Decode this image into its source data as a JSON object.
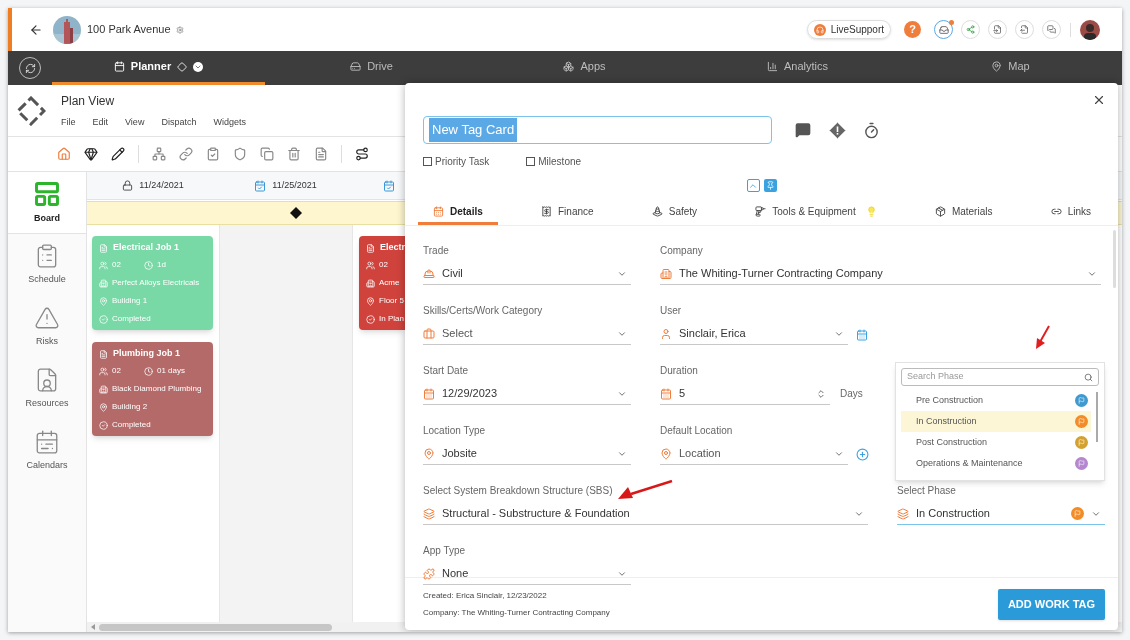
{
  "header": {
    "project_name": "100 Park Avenue",
    "live_support": "LiveSupport",
    "help": "?"
  },
  "nav": {
    "tabs": [
      {
        "label": "Planner",
        "selected": true
      },
      {
        "label": "Drive",
        "selected": false
      },
      {
        "label": "Apps",
        "selected": false
      },
      {
        "label": "Analytics",
        "selected": false
      },
      {
        "label": "Map",
        "selected": false
      }
    ]
  },
  "plan_view": {
    "title": "Plan View",
    "menu": [
      "File",
      "Edit",
      "View",
      "Dispatch",
      "Widgets"
    ]
  },
  "sidebar": {
    "items": [
      {
        "label": "Board",
        "selected": true
      },
      {
        "label": "Schedule",
        "selected": false
      },
      {
        "label": "Risks",
        "selected": false
      },
      {
        "label": "Resources",
        "selected": false
      },
      {
        "label": "Calendars",
        "selected": false
      }
    ]
  },
  "timeline": {
    "dates": [
      {
        "label": "11/24/2021",
        "locked": true
      },
      {
        "label": "11/25/2021",
        "locked": false
      },
      {
        "locked": false
      }
    ]
  },
  "board": {
    "columns": [
      {
        "cards": [
          {
            "title": "Electrical Job 1",
            "color": "#79d9a6",
            "crew": "02",
            "duration": "1d",
            "company": "Perfect Alloys Electricals",
            "location": "Building 1",
            "status": "Completed"
          },
          {
            "title": "Plumbing Job 1",
            "color": "#b46a69",
            "crew": "02",
            "duration": "01 days",
            "company": "Black Diamond Plumbing",
            "location": "Building 2",
            "status": "Completed"
          }
        ]
      },
      {},
      {
        "cards": [
          {
            "title": "Electr",
            "color": "#d0433d",
            "crew": "02",
            "company": "Acme",
            "location": "Floor 5",
            "status": "In Plan"
          }
        ]
      }
    ]
  },
  "modal": {
    "title": "New Tag Card",
    "checkboxes": [
      {
        "label": "Priority Task",
        "checked": false
      },
      {
        "label": "Milestone",
        "checked": false
      }
    ],
    "tabs": [
      {
        "kind": "details",
        "label": "Details",
        "selected": true
      },
      {
        "kind": "finance",
        "label": "Finance",
        "selected": false
      },
      {
        "kind": "safety",
        "label": "Safety",
        "selected": false
      },
      {
        "kind": "tools",
        "label": "Tools & Equipment",
        "selected": false
      },
      {
        "kind": "materials",
        "label": "Materials",
        "selected": false
      },
      {
        "kind": "links",
        "label": "Links",
        "selected": false
      }
    ],
    "rows": [
      [
        {
          "kind": "trade",
          "label": "Trade",
          "value": "Civil"
        },
        {
          "kind": "company",
          "label": "Company",
          "value": "The Whiting-Turner Contracting Company"
        }
      ],
      [
        {
          "kind": "skills",
          "label": "Skills/Certs/Work Category",
          "placeholder": "Select"
        },
        {
          "kind": "user",
          "label": "User",
          "value": "Sinclair, Erica"
        }
      ],
      [
        {
          "kind": "date",
          "label": "Start Date",
          "value": "12/29/2023"
        },
        {
          "kind": "duration",
          "label": "Duration",
          "value": "5",
          "suffix": "Days"
        }
      ],
      [
        {
          "kind": "location",
          "label": "Location Type",
          "value": "Jobsite"
        },
        {
          "kind": "default_location",
          "label": "Default Location",
          "placeholder": "Location"
        }
      ],
      [
        {
          "kind": "sbs",
          "label": "Select System Breakdown Structure (SBS)",
          "value": "Structural - Substructure & Foundation"
        },
        {
          "kind": "phase",
          "label": "Select Phase",
          "value": "In Construction",
          "color": "#f28c28"
        }
      ],
      [
        {
          "kind": "app",
          "label": "App Type",
          "value": "None"
        }
      ]
    ],
    "phase_dropdown": {
      "placeholder": "Search Phase",
      "options": [
        {
          "label": "Pre Construction",
          "color": "#3e9ad0",
          "selected": false
        },
        {
          "label": "In Construction",
          "color": "#f28c28",
          "selected": true
        },
        {
          "label": "Post Construction",
          "color": "#d4a12f",
          "selected": false
        },
        {
          "label": "Operations & Maintenance",
          "color": "#b487cf",
          "selected": false
        }
      ]
    },
    "footer": {
      "created": "Created: Erica Sinclair, 12/23/2022",
      "company": "Company: The Whiting-Turner Contracting Company",
      "button": "ADD WORK TAG"
    }
  }
}
